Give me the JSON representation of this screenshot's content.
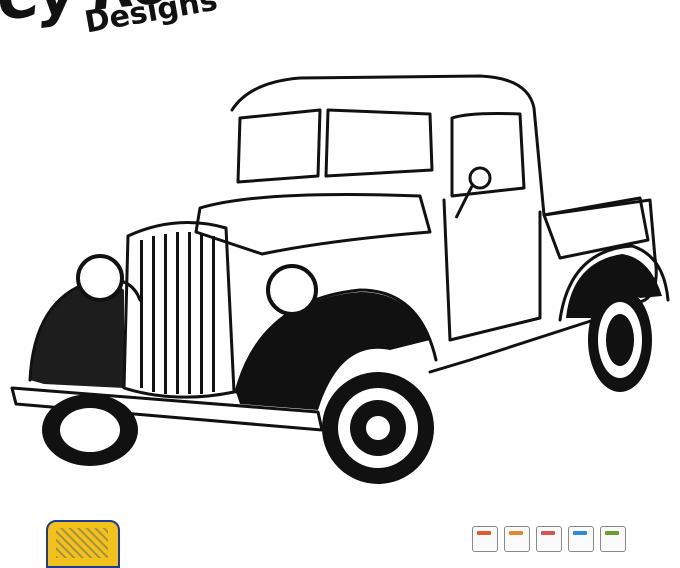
{
  "logo": {
    "brand": "Cy Ro",
    "tagline": "Designs"
  },
  "colors": {
    "ink": "#111111",
    "paper": "#ffffff",
    "badge_yellow": "#f3c21a",
    "badge_blue": "#1d3b8f"
  },
  "artwork": {
    "subject_icon": "vintage-pickup-truck-icon",
    "style": "black-and-white line art"
  },
  "footer": {
    "badge_icon": "shield-badge-icon",
    "file_format_icons": [
      "file-icon-1",
      "file-icon-2",
      "file-icon-3",
      "file-icon-4",
      "file-icon-5"
    ]
  }
}
